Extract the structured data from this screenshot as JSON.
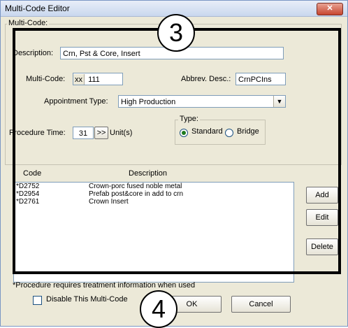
{
  "window": {
    "title": "Multi-Code Editor",
    "close_label": "✕"
  },
  "callouts": {
    "top": "3",
    "bottom": "4"
  },
  "multicode_group": {
    "legend": "Multi-Code:",
    "description_label": "Description:",
    "description_value": "Crn, Pst & Core, Insert",
    "multicode_label": "Multi-Code:",
    "multicode_prefix": "xx",
    "multicode_value": "111",
    "abbrev_label": "Abbrev. Desc.:",
    "abbrev_value": "CrnPCIns",
    "appt_type_label": "Appointment Type:",
    "appt_type_value": "High Production",
    "proc_time_label": "Procedure Time:",
    "proc_time_value": "31",
    "proc_time_button": ">>",
    "units_label": "Unit(s)",
    "type_legend": "Type:",
    "type_options": [
      {
        "label": "Standard",
        "selected": true
      },
      {
        "label": "Bridge",
        "selected": false
      }
    ]
  },
  "table": {
    "columns": [
      "Code",
      "Description"
    ],
    "rows": [
      {
        "code": "*D2752",
        "description": "Crown-porc fused noble metal"
      },
      {
        "code": "*D2954",
        "description": "Prefab post&core in add to crn"
      },
      {
        "code": "*D2761",
        "description": "Crown Insert"
      }
    ]
  },
  "side_buttons": {
    "add": "Add",
    "edit": "Edit",
    "delete": "Delete"
  },
  "footer": {
    "note": "*Procedure requires treatment information when used",
    "disable_label": "Disable This Multi-Code",
    "ok_label": "OK",
    "cancel_label": "Cancel"
  },
  "colors": {
    "highlight_border": "#000000",
    "dialog_bg": "#ece9d8",
    "close_button": "#c7452f"
  }
}
